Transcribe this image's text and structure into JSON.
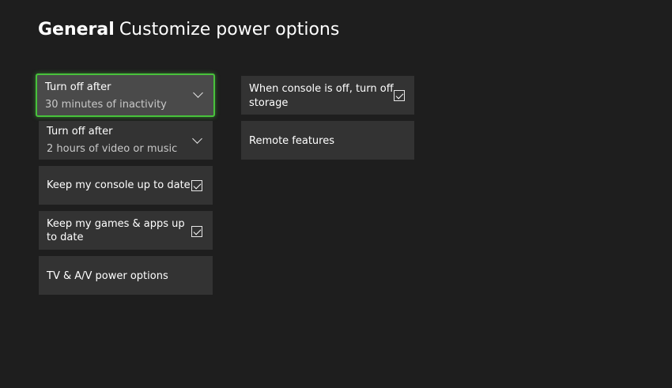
{
  "header": {
    "section": "General",
    "subtitle": "Customize power options"
  },
  "left_column": {
    "turn_off_inactivity": {
      "label": "Turn off after",
      "value": "30 minutes of inactivity"
    },
    "turn_off_video": {
      "label": "Turn off after",
      "value": "2 hours of video or music"
    },
    "keep_console_updated": {
      "label": "Keep my console up to date",
      "checked": true
    },
    "keep_games_updated": {
      "label_line1": "Keep my games & apps up",
      "label_line2": "to date",
      "checked": true
    },
    "tv_av_power": {
      "label": "TV & A/V power options"
    }
  },
  "right_column": {
    "turn_off_storage": {
      "label_line1": "When console is off, turn off",
      "label_line2": "storage",
      "checked": true
    },
    "remote_features": {
      "label": "Remote features"
    }
  },
  "colors": {
    "background": "#1e1e1e",
    "tile": "#333333",
    "focused_tile": "#4a4a4a",
    "focus_accent": "#48c23c"
  },
  "icons": {
    "dropdown": "chevron-down-icon",
    "checked": "checkbox-checked-icon"
  }
}
